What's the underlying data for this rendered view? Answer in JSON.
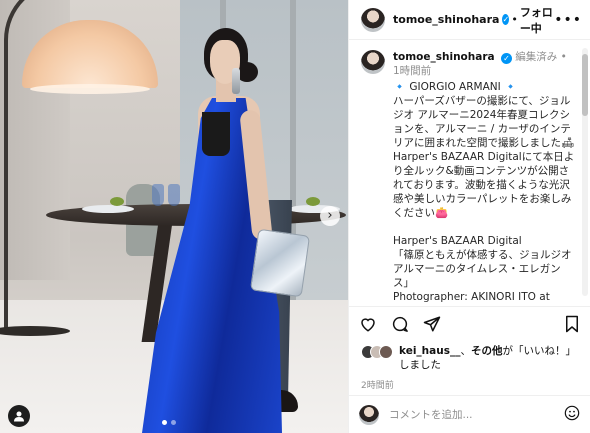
{
  "header": {
    "username": "tomoe_shinohara",
    "separator": "•",
    "follow_label": "フォロー中",
    "more_label": "•••"
  },
  "post": {
    "author": "tomoe_shinohara",
    "edited": "編集済み",
    "dot": "•",
    "time": "1時間前",
    "caption": "🔹 GIORGIO ARMANI 🔹\nハーパーズバザーの撮影にて、ジョルジオ アルマーニ2024年春夏コレクションを、アルマーニ / カーザのインテリアに囲まれた空間で撮影しました🛋\nHarper's BAZAAR Digitalにて本日より全ルック&動画コンテンツが公開されております。波動を描くような光沢感や美しいカラーパレットをお楽しみください👛\n\nHarper's BAZAAR Digital\n「篠原ともえが体感する、ジョルジオ アルマーニのタイムレス・エレガンス」\nPhotographer: AKINORI ITO at AOSORA\nFashion Styling: MAKI YANAGITA\nInterior Styling: MASAYO MOTEGI"
  },
  "likes": {
    "user": "kei_haus__",
    "connector": "、",
    "others": "その他",
    "suffix": "が「いいね！」しました"
  },
  "time_ago": "2時間前",
  "comment_box": {
    "placeholder": "コメントを追加..."
  },
  "carousel": {
    "next_label": "›",
    "slide_count": 2,
    "active_index": 0
  },
  "icons": {
    "heart": "heart-icon",
    "comment": "comment-icon",
    "share": "share-icon",
    "bookmark": "bookmark-icon",
    "emoji": "emoji-icon",
    "tag": "user-tag-icon",
    "verified": "verified-badge-icon",
    "more": "more-options-icon"
  },
  "colors": {
    "verified": "#0095f6",
    "dress": "#1f4fe0",
    "muted": "#8e8e8e"
  }
}
